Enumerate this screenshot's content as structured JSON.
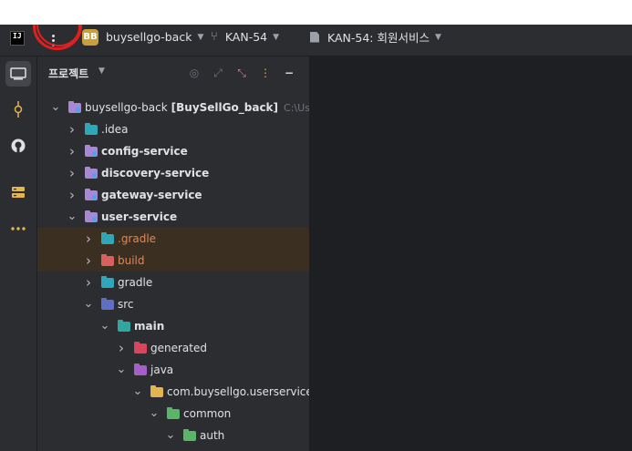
{
  "titlebar": {
    "logo_text": "IJ",
    "project_badge": "BB",
    "project_name": "buysellgo-back",
    "branch_name": "KAN-54",
    "task_name": "KAN-54: 회원서비스"
  },
  "leftbar": {
    "icons": [
      "project-icon",
      "commit-icon",
      "github-icon",
      "services-icon",
      "more-icon"
    ]
  },
  "panel": {
    "title": "프로젝트",
    "header_icons": [
      "target-icon",
      "expand-icon",
      "collapse-icon",
      "options-icon",
      "minimize-icon"
    ]
  },
  "tree": [
    {
      "label": "buysellgo-back",
      "extra": "[BuySellGo_back]",
      "path": "C:\\Users\\",
      "depth": 0,
      "expanded": true,
      "icon": "module",
      "bold": false
    },
    {
      "label": ".idea",
      "depth": 1,
      "expanded": false,
      "icon": "cyan",
      "bold": false
    },
    {
      "label": "config-service",
      "depth": 1,
      "expanded": false,
      "icon": "module",
      "bold": true
    },
    {
      "label": "discovery-service",
      "depth": 1,
      "expanded": false,
      "icon": "module",
      "bold": true
    },
    {
      "label": "gateway-service",
      "depth": 1,
      "expanded": false,
      "icon": "module",
      "bold": true
    },
    {
      "label": "user-service",
      "depth": 1,
      "expanded": true,
      "icon": "module",
      "bold": true
    },
    {
      "label": ".gradle",
      "depth": 2,
      "expanded": false,
      "icon": "cyan",
      "bold": false,
      "orange": true,
      "highlight": true
    },
    {
      "label": "build",
      "depth": 2,
      "expanded": false,
      "icon": "red",
      "bold": false,
      "orange": true,
      "highlight": true
    },
    {
      "label": "gradle",
      "depth": 2,
      "expanded": false,
      "icon": "cyan",
      "bold": false
    },
    {
      "label": "src",
      "depth": 2,
      "expanded": true,
      "icon": "src",
      "bold": false
    },
    {
      "label": "main",
      "depth": 3,
      "expanded": true,
      "icon": "main",
      "bold": true
    },
    {
      "label": "generated",
      "depth": 4,
      "expanded": false,
      "icon": "gen",
      "bold": false
    },
    {
      "label": "java",
      "depth": 4,
      "expanded": true,
      "icon": "java",
      "bold": false
    },
    {
      "label": "com.buysellgo.userservice",
      "depth": 5,
      "expanded": true,
      "icon": "pkg",
      "bold": false
    },
    {
      "label": "common",
      "depth": 6,
      "expanded": true,
      "icon": "green",
      "bold": false
    },
    {
      "label": "auth",
      "depth": 7,
      "expanded": true,
      "icon": "green",
      "bold": false
    }
  ],
  "colors": {
    "background": "#1e1f22",
    "toolbar": "#2b2d30",
    "highlight_row": "#3b2f22",
    "orange_text": "#e08855",
    "annotation": "#e02020"
  }
}
